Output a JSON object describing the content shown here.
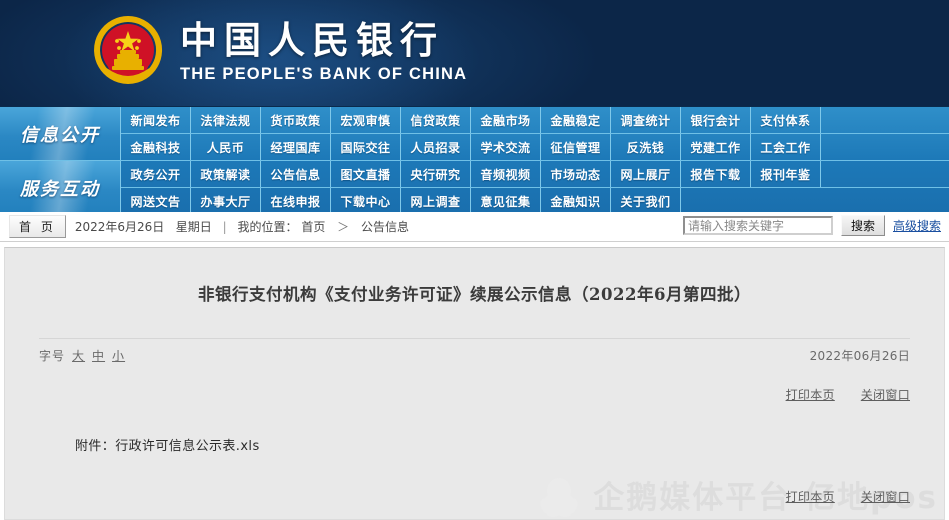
{
  "header": {
    "bank_name_cn": "中国人民银行",
    "bank_name_en": "THE PEOPLE'S BANK OF CHINA",
    "emblem_icon": "china-national-emblem-icon"
  },
  "nav": {
    "groups": [
      {
        "category": "信息公开",
        "rows": [
          [
            "新闻发布",
            "法律法规",
            "货币政策",
            "宏观审慎",
            "信贷政策",
            "金融市场",
            "金融稳定",
            "调查统计",
            "银行会计",
            "支付体系"
          ],
          [
            "金融科技",
            "人民币",
            "经理国库",
            "国际交往",
            "人员招录",
            "学术交流",
            "征信管理",
            "反洗钱",
            "党建工作",
            "工会工作"
          ]
        ]
      },
      {
        "category": "服务互动",
        "rows": [
          [
            "政务公开",
            "政策解读",
            "公告信息",
            "图文直播",
            "央行研究",
            "音频视频",
            "市场动态",
            "网上展厅",
            "报告下载",
            "报刊年鉴"
          ],
          [
            "网送文告",
            "办事大厅",
            "在线申报",
            "下载中心",
            "网上调查",
            "意见征集",
            "金融知识",
            "关于我们"
          ]
        ]
      }
    ]
  },
  "breadcrumb": {
    "home_button": "首 页",
    "date": "2022年6月26日",
    "weekday": "星期日",
    "divider": "|",
    "location_label": "我的位置：",
    "path_home": "首页",
    "arrow": "＞",
    "path_current": "公告信息"
  },
  "search": {
    "placeholder": "请输入搜索关键字",
    "value": "",
    "button_label": "搜索",
    "advanced_label": "高级搜索"
  },
  "article": {
    "title": "非银行支付机构《支付业务许可证》续展公示信息（2022年6月第四批）",
    "fontsize_label": "字号",
    "fontsize_large": "大",
    "fontsize_medium": "中",
    "fontsize_small": "小",
    "publish_date": "2022年06月26日",
    "print_label": "打印本页",
    "close_label": "关闭窗口",
    "attachment_label": "附件：",
    "attachment_file": "行政许可信息公示表.xls"
  },
  "watermark": {
    "text": "企鹅媒体平台 亿地pos",
    "icon": "qq-penguin-icon"
  },
  "colors": {
    "banner_dark": "#0c2648",
    "nav_blue": "#1d79b8",
    "nav_cat_blue": "#2b88c4",
    "content_gray": "#e9e9e9",
    "link_blue": "#1a4fa0",
    "text_gray": "#6a6a6a"
  }
}
